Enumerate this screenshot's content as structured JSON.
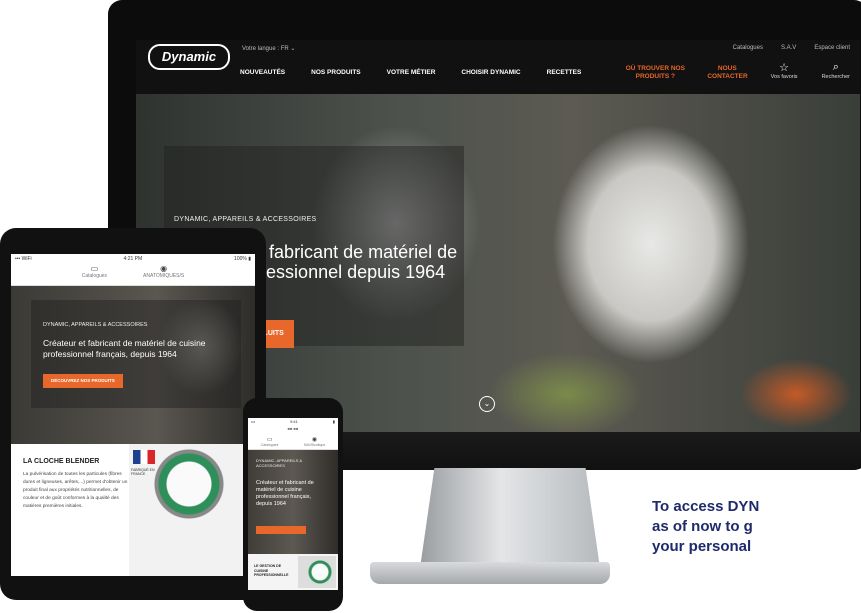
{
  "site": {
    "topbar": {
      "language": "Votre langue : FR ⌄",
      "links": [
        "Catalogues",
        "S.A.V",
        "Espace client"
      ]
    },
    "logo": "Dynamic",
    "nav": [
      "NOUVEAUTÉS",
      "NOS PRODUITS",
      "VOTRE MÉTIER",
      "CHOISIR DYNAMIC",
      "RECETTES"
    ],
    "nav_where": "OÙ TROUVER NOS PRODUITS ?",
    "nav_contact": "NOUS CONTACTER",
    "nav_icons": [
      {
        "label": "Vos favoris",
        "glyph": "☆"
      },
      {
        "label": "Rechercher",
        "glyph": "⌕"
      }
    ],
    "hero": {
      "kicker": "DYNAMIC, APPAREILS & ACCESSOIRES",
      "title": "Créateur et fabricant de matériel de cuisine professionnel depuis 1964",
      "button": "...UITS"
    }
  },
  "tablet": {
    "status_left": "••• WiFi",
    "status_time": "4:21 PM",
    "status_right": "100% ▮",
    "links": [
      "Catalogues",
      "ANATOMIQUES/S"
    ],
    "hero_kicker": "DYNAMIC, APPAREILS & ACCESSOIRES",
    "hero_title": "Créateur et fabricant de matériel de cuisine professionnel français, depuis 1964",
    "hero_button": "DÉCOUVREZ NOS PRODUITS",
    "card_title": "LA CLOCHE BLENDER",
    "card_body": "La pulvérisation de toutes les particules (fibres dures et ligneuses, arêtes,...) permet d'obtenir un produit final aux propriétés nutritionnelles, de couleur et de goût conformes à la qualité des matières premières initiales.",
    "flag_label": "FABRIQUÉ EN FRANCE"
  },
  "phone": {
    "status_left": "•••",
    "status_time": "9:41",
    "status_right": "▮",
    "top": "■■ ■■",
    "links": [
      "Catalogues",
      "SAV/Boutique"
    ],
    "hero_kicker": "DYNAMIC, APPAREILS & ACCESSOIRES",
    "hero_title": "Créateur et fabricant de matériel de cuisine professionnel français, depuis 1964",
    "card_title": "LE GESTION DE CUISINE PROFESSIONNELLE"
  },
  "promo": {
    "line1": "To access DYN",
    "line2": "as of now to g",
    "line3": "your personal"
  },
  "colors": {
    "accent": "#e8672a",
    "promo_text": "#1e2a6e"
  }
}
